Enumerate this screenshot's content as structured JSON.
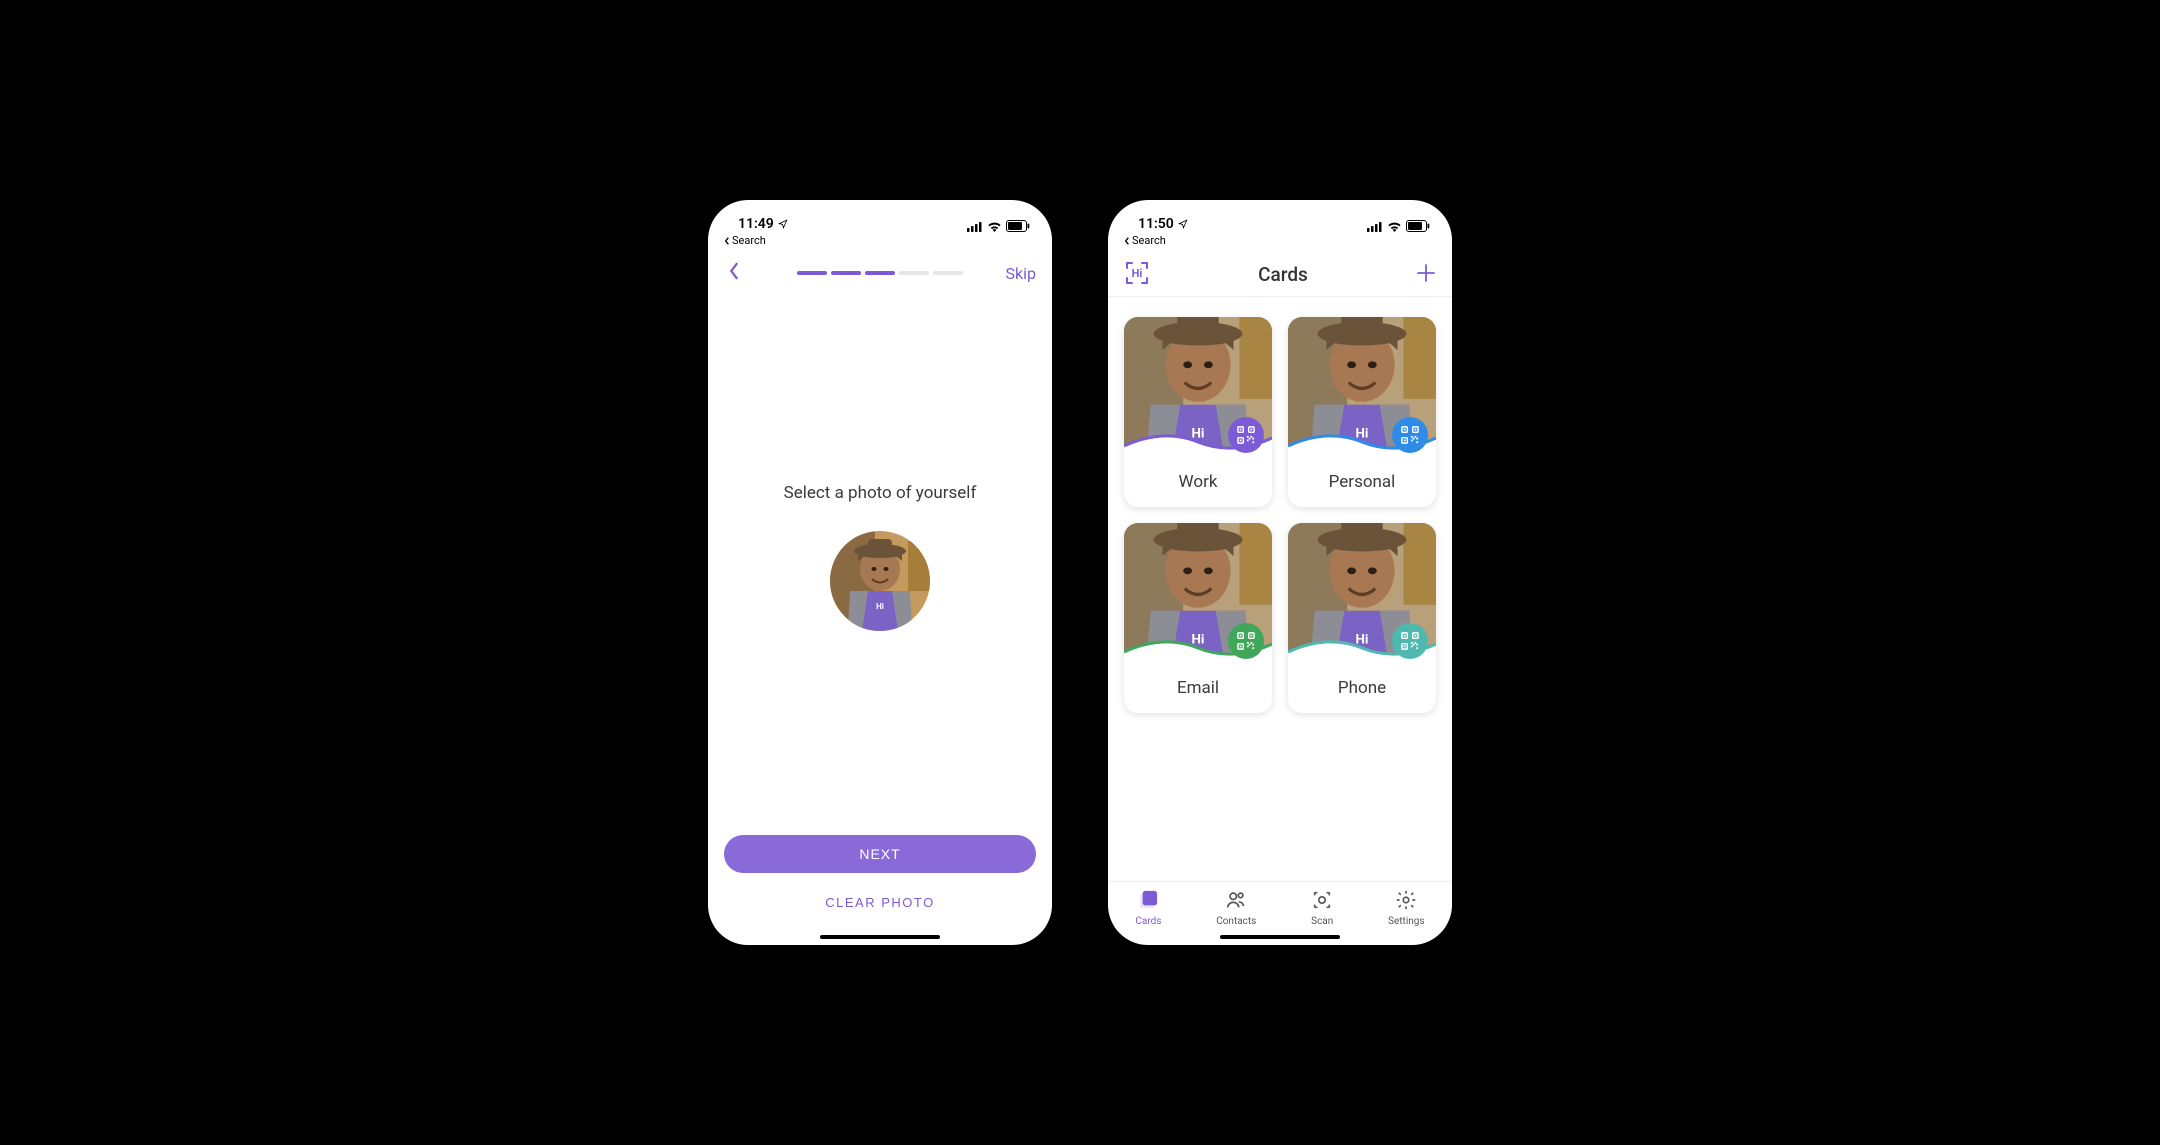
{
  "screen1": {
    "status_time": "11:49",
    "breadcrumb": "Search",
    "skip_label": "Skip",
    "progress_total": 5,
    "progress_filled": 3,
    "heading": "Select a photo of yourself",
    "next_label": "NEXT",
    "clear_label": "CLEAR PHOTO"
  },
  "screen2": {
    "status_time": "11:50",
    "breadcrumb": "Search",
    "logo_text": "Hi",
    "title": "Cards",
    "cards": [
      {
        "label": "Work",
        "accent": "#7c5bd6"
      },
      {
        "label": "Personal",
        "accent": "#2f8be6"
      },
      {
        "label": "Email",
        "accent": "#3fa65a"
      },
      {
        "label": "Phone",
        "accent": "#4fb9af"
      }
    ],
    "tabs": [
      {
        "label": "Cards",
        "icon": "cards",
        "active": true
      },
      {
        "label": "Contacts",
        "icon": "contacts",
        "active": false
      },
      {
        "label": "Scan",
        "icon": "scan",
        "active": false
      },
      {
        "label": "Settings",
        "icon": "settings",
        "active": false
      }
    ]
  }
}
